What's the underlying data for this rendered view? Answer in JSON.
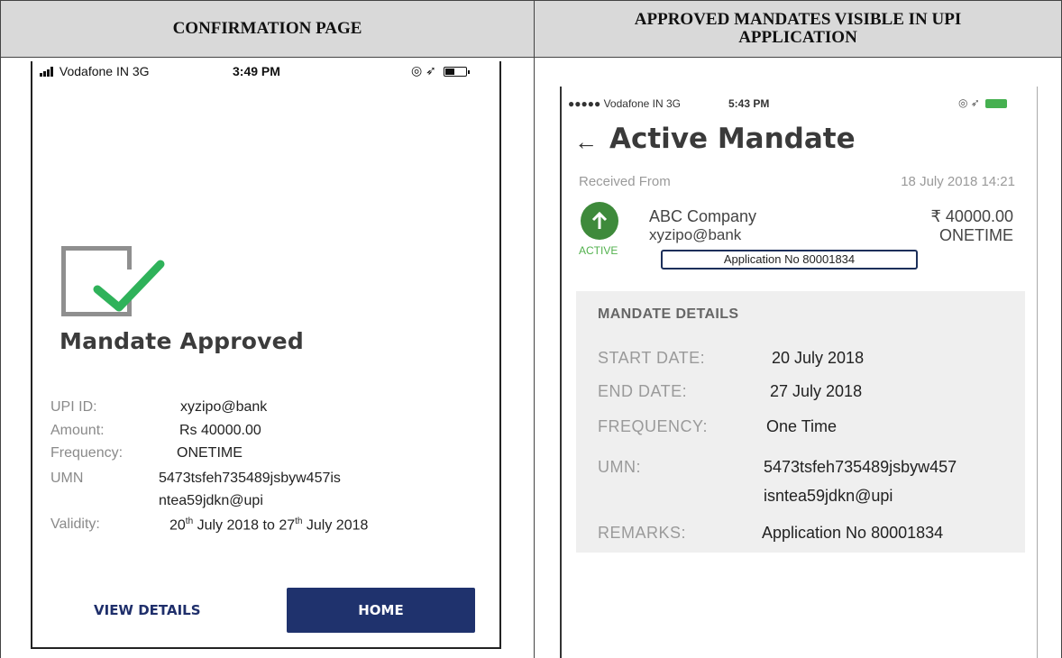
{
  "headers": {
    "left": "CONFIRMATION PAGE",
    "right": "APPROVED MANDATES VISIBLE IN UPI APPLICATION"
  },
  "confirmation": {
    "status_bar": {
      "carrier": "Vodafone IN  3G",
      "time": "3:49 PM",
      "icons": "◎ ➶"
    },
    "heading": "Mandate Approved",
    "fields": [
      {
        "label": "UPI ID:",
        "value": "xyzipo@bank"
      },
      {
        "label": "Amount:",
        "value": "Rs 40000.00"
      },
      {
        "label": "Frequency:",
        "value": "ONETIME"
      },
      {
        "label": "UMN",
        "value": "5473tsfeh735489jsbyw457is",
        "value2": "ntea59jdkn@upi"
      },
      {
        "label": "Validity:",
        "value": "20th July 2018 to 27th July 2018"
      }
    ],
    "validity": {
      "d1": "20",
      "s1": "th",
      "m1": " July 2018 to ",
      "d2": "27",
      "s2": "th",
      "m2": " July 2018"
    },
    "buttons": {
      "view": "VIEW DETAILS",
      "home": "HOME"
    }
  },
  "active": {
    "status_bar": {
      "carrier": "●●●●● Vodafone IN  3G",
      "time": "5:43 PM",
      "icons": "◎ ➶"
    },
    "back_icon": "←",
    "title": "Active Mandate",
    "received_label": "Received From",
    "received_date": "18 July 2018 14:21",
    "company": "ABC Company",
    "vpa": "xyzipo@bank",
    "amount": "₹ 40000.00",
    "frequency": "ONETIME",
    "status": "ACTIVE",
    "application": "Application No 80001834",
    "details_heading": "MANDATE DETAILS",
    "details": [
      {
        "label": "START DATE:",
        "value": "20 July 2018"
      },
      {
        "label": "END DATE:",
        "value": "27 July 2018"
      },
      {
        "label": "FREQUENCY:",
        "value": "One Time"
      },
      {
        "label": "UMN:",
        "value": "5473tsfeh735489jsbyw457",
        "value2": "isntea59jdkn@upi"
      },
      {
        "label": "REMARKS:",
        "value": "Application No 80001834"
      }
    ]
  },
  "colors": {
    "navy": "#1f326d",
    "green": "#3e8a3b",
    "check": "#2fb25a"
  }
}
